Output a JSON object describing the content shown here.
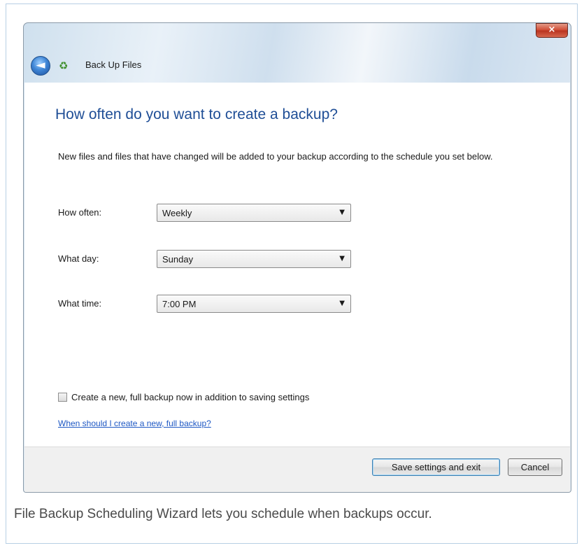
{
  "window": {
    "close_label": "×",
    "back_glyph": "◄",
    "icon": "backup-icon",
    "title": "Back Up Files"
  },
  "main": {
    "heading": "How often do you want to create a backup?",
    "description": "New files and files that have changed will be added to your backup according to the schedule you set below.",
    "fields": [
      {
        "label": "How often:",
        "value": "Weekly"
      },
      {
        "label": "What day:",
        "value": "Sunday"
      },
      {
        "label": "What time:",
        "value": "7:00 PM"
      }
    ],
    "checkbox": {
      "label": "Create a new, full backup now in addition to saving settings",
      "checked": false
    },
    "help_link": "When should I create a new, full backup?"
  },
  "footer": {
    "save_label": "Save settings and exit",
    "cancel_label": "Cancel"
  },
  "caption": "File Backup Scheduling Wizard lets you schedule when backups occur.",
  "colors": {
    "heading": "#1f4e96",
    "link": "#1e58c4",
    "close": "#cf4b34"
  }
}
